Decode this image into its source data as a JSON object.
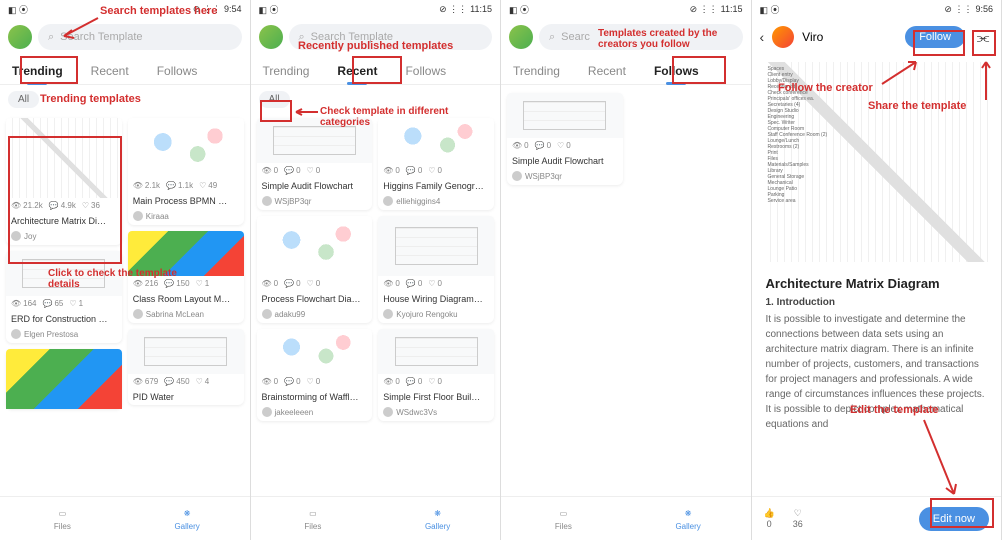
{
  "annotations": {
    "search": "Search templates here",
    "trending": "Trending templates",
    "recent": "Recently published templates",
    "follows": "Templates created by the creators you follow",
    "categories": "Check template in different categories",
    "click_detail": "Click to check the template details",
    "follow_creator": "Follow the creator",
    "share": "Share the template",
    "edit": "Edit the template"
  },
  "common": {
    "search_placeholder": "Search Template",
    "tabs": {
      "trending": "Trending",
      "recent": "Recent",
      "follows": "Follows"
    },
    "nav": {
      "files": "Files",
      "gallery": "Gallery"
    },
    "chip_all": "All"
  },
  "status": {
    "left_signal": "◧ ⦿",
    "icons": "⊘ ⋮⋮",
    "time1": "9:54",
    "time2": "11:15",
    "time3": "11:15",
    "time4": "9:56"
  },
  "screen1": {
    "cards": [
      {
        "title": "Architecture Matrix Di…",
        "author": "Joy",
        "views": "21.2k",
        "comments": "4.9k",
        "likes": "36"
      },
      {
        "title": "Main Process BPMN …",
        "author": "Kiraaa",
        "views": "2.1k",
        "comments": "1.1k",
        "likes": "49"
      },
      {
        "title": "ERD for Construction …",
        "author": "Elgen Prestosa",
        "views": "164",
        "comments": "65",
        "likes": "1"
      },
      {
        "title": "Class Room Layout M…",
        "author": "Sabrina McLean",
        "views": "216",
        "comments": "150",
        "likes": "1"
      },
      {
        "title": "PID Water",
        "views": "679",
        "comments": "450",
        "likes": "4"
      }
    ]
  },
  "screen2": {
    "cards": [
      {
        "title": "Simple Audit Flowchart",
        "author": "WSjBP3qr",
        "views": "0",
        "comments": "0",
        "likes": "0"
      },
      {
        "title": "Higgins Family Genogr…",
        "author": "elliehiggins4",
        "views": "0",
        "comments": "0",
        "likes": "0"
      },
      {
        "title": "Process Flowchart Dia…",
        "author": "adaku99",
        "views": "0",
        "comments": "0",
        "likes": "0"
      },
      {
        "title": "House Wiring Diagram…",
        "author": "Kyojuro Rengoku",
        "views": "0",
        "comments": "0",
        "likes": "0"
      },
      {
        "title": "Brainstorming of Waffl…",
        "author": "jakeeleeen",
        "views": "0",
        "comments": "0",
        "likes": "0"
      },
      {
        "title": "Simple First Floor Buil…",
        "author": "WSdwc3Vs",
        "views": "0",
        "comments": "0",
        "likes": "0"
      }
    ]
  },
  "screen3": {
    "card": {
      "title": "Simple Audit Flowchart",
      "author": "WSjBP3qr",
      "views": "0",
      "comments": "0",
      "likes": "0"
    }
  },
  "screen4": {
    "creator": "Viro",
    "follow": "Follow",
    "title": "Architecture Matrix Diagram",
    "sub": "1. Introduction",
    "body": "It is possible to investigate and determine the connections between data sets using an architecture matrix diagram. There is an infinite number of projects, customers, and transactions for project managers and professionals. A wide range of circumstances influences these projects. It is possible to depict complex mathematical equations and",
    "likes": "0",
    "hearts": "36",
    "edit": "Edit now",
    "matrix_labels": [
      "Spaces",
      "Client entry",
      "Lobby/Display",
      "Receptionist",
      "Check conference",
      "Principals' offices ea.",
      "Secretaries (4)",
      "Design Studio",
      "Engineering",
      "Spec. Writer",
      "Computer Room",
      "Staff Conference Room (2)",
      "Lounge/Lunch",
      "Restrooms (2)",
      "Print",
      "Files",
      "Materials/Samples",
      "Library",
      "General Storage",
      "Mechanical",
      "Lounge Patio",
      "Parking",
      "Service area"
    ]
  }
}
